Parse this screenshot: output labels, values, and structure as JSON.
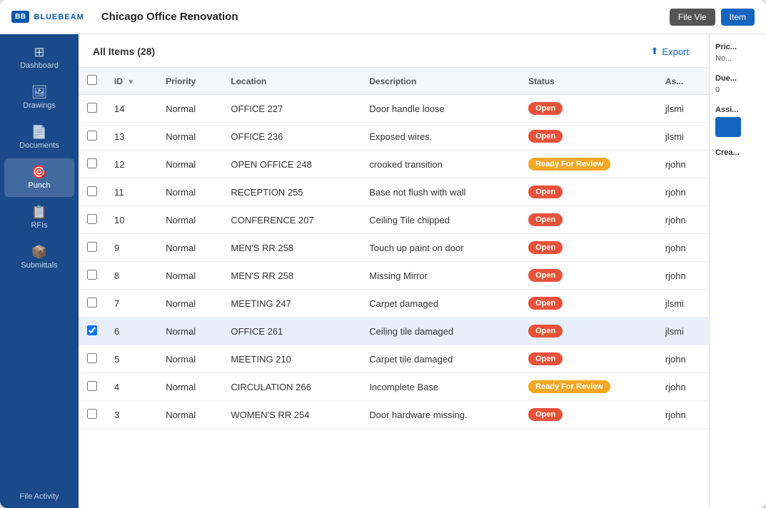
{
  "titleBar": {
    "logoText": "BLUEBEAM",
    "projectTitle": "Chicago Office Renovation",
    "fileViewBtn": "File Vie",
    "itemBtn": "Item"
  },
  "sidebar": {
    "items": [
      {
        "id": "dashboard",
        "label": "Dashboard",
        "icon": "⊞"
      },
      {
        "id": "drawings",
        "label": "Drawings",
        "icon": "🖼"
      },
      {
        "id": "documents",
        "label": "Documents",
        "icon": "📄"
      },
      {
        "id": "punch",
        "label": "Punch",
        "icon": "🎯",
        "active": true
      },
      {
        "id": "rfis",
        "label": "RFIs",
        "icon": "📋"
      },
      {
        "id": "submittals",
        "label": "Submittals",
        "icon": "📦"
      }
    ],
    "bottomLabel": "File Activity"
  },
  "content": {
    "title": "All Items (28)",
    "exportLabel": "Export",
    "columns": [
      {
        "id": "checkbox",
        "label": ""
      },
      {
        "id": "id",
        "label": "ID",
        "sortable": true
      },
      {
        "id": "priority",
        "label": "Priority"
      },
      {
        "id": "location",
        "label": "Location"
      },
      {
        "id": "description",
        "label": "Description"
      },
      {
        "id": "status",
        "label": "Status"
      },
      {
        "id": "assigned",
        "label": "As..."
      }
    ],
    "rows": [
      {
        "id": 14,
        "priority": "Normal",
        "location": "OFFICE 227",
        "description": "Door handle loose",
        "status": "Open",
        "assigned": "jlsmi",
        "selected": false
      },
      {
        "id": 13,
        "priority": "Normal",
        "location": "OFFICE 236",
        "description": "Exposed wires.",
        "status": "Open",
        "assigned": "jlsmi",
        "selected": false
      },
      {
        "id": 12,
        "priority": "Normal",
        "location": "OPEN OFFICE 248",
        "description": "crooked transition",
        "status": "Ready For Review",
        "assigned": "rjohn",
        "selected": false
      },
      {
        "id": 11,
        "priority": "Normal",
        "location": "RECEPTION 255",
        "description": "Base not flush with wall",
        "status": "Open",
        "assigned": "rjohn",
        "selected": false
      },
      {
        "id": 10,
        "priority": "Normal",
        "location": "CONFERENCE 207",
        "description": "Ceiling Tile chipped",
        "status": "Open",
        "assigned": "rjohn",
        "selected": false
      },
      {
        "id": 9,
        "priority": "Normal",
        "location": "MEN'S RR 258",
        "description": "Touch up paint on door",
        "status": "Open",
        "assigned": "rjohn",
        "selected": false
      },
      {
        "id": 8,
        "priority": "Normal",
        "location": "MEN'S RR 258",
        "description": "Missing Mirror",
        "status": "Open",
        "assigned": "rjohn",
        "selected": false
      },
      {
        "id": 7,
        "priority": "Normal",
        "location": "MEETING 247",
        "description": "Carpet damaged",
        "status": "Open",
        "assigned": "jlsmi",
        "selected": false
      },
      {
        "id": 6,
        "priority": "Normal",
        "location": "OFFICE 261",
        "description": "Ceiling tile damaged",
        "status": "Open",
        "assigned": "jlsmi",
        "selected": true
      },
      {
        "id": 5,
        "priority": "Normal",
        "location": "MEETING 210",
        "description": "Carpet tile damaged",
        "status": "Open",
        "assigned": "rjohn",
        "selected": false
      },
      {
        "id": 4,
        "priority": "Normal",
        "location": "CIRCULATION 266",
        "description": "Incomplete Base",
        "status": "Ready For Review",
        "assigned": "rjohn",
        "selected": false
      },
      {
        "id": 3,
        "priority": "Normal",
        "location": "WOMEN'S RR 254",
        "description": "Door hardware missing.",
        "status": "Open",
        "assigned": "rjohn",
        "selected": false
      }
    ]
  },
  "rightPanel": {
    "priceLabel": "Pric...",
    "priceValue": "No...",
    "dueDateLabel": "Due...",
    "dueDateValue": "0",
    "assignedLabel": "Assi...",
    "createdLabel": "Crea..."
  }
}
